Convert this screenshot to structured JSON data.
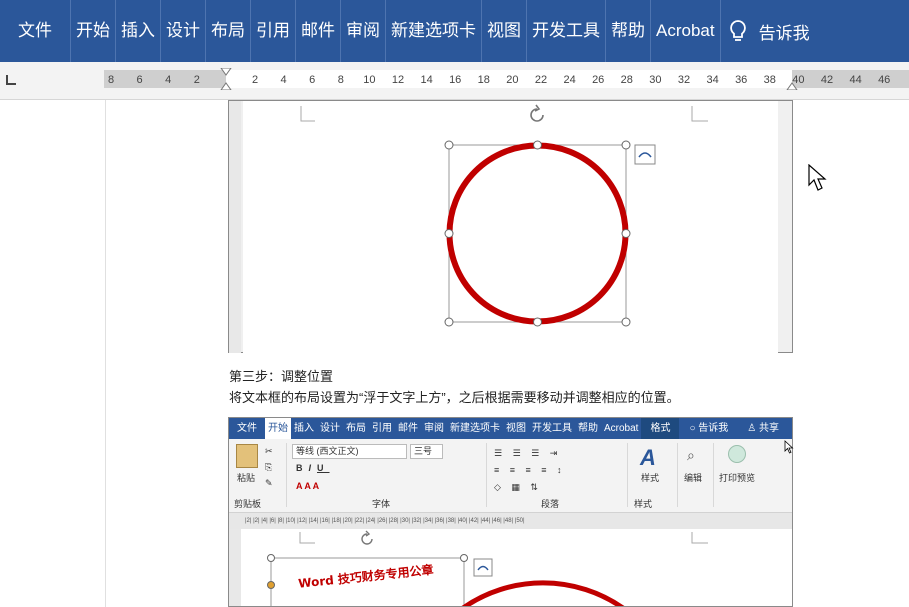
{
  "ribbon": {
    "tabs": [
      "文件",
      "开始",
      "插入",
      "设计",
      "布局",
      "引用",
      "邮件",
      "审阅",
      "新建选项卡",
      "视图",
      "开发工具",
      "帮助",
      "Acrobat"
    ],
    "tell_me": "告诉我"
  },
  "ruler": {
    "left_labels": [
      "8",
      "6",
      "4",
      "2"
    ],
    "right_labels": [
      "2",
      "4",
      "6",
      "8",
      "10",
      "12",
      "14",
      "16",
      "18",
      "20",
      "22",
      "24",
      "26",
      "28",
      "30",
      "32",
      "34",
      "36",
      "38",
      "40",
      "42",
      "44",
      "46"
    ]
  },
  "doc": {
    "step": "第三步：调整位置",
    "desc": "将文本框的布局设置为“浮于文字上方”，之后根据需要移动并调整相应的位置。"
  },
  "mini": {
    "tabs": [
      "文件",
      "开始",
      "插入",
      "设计",
      "布局",
      "引用",
      "邮件",
      "审阅",
      "新建选项卡",
      "视图",
      "开发工具",
      "帮助",
      "Acrobat"
    ],
    "format_tab": "格式",
    "tell_me": "告诉我",
    "share": "共享",
    "paste": "粘贴",
    "font_name": "等线 (西文正文)",
    "font_size": "三号",
    "styles": "样式",
    "edit": "编辑",
    "print_preview": "打印预览",
    "groups": {
      "clipboard": "剪贴板",
      "font": "字体",
      "paragraph": "段落",
      "styles": "样式"
    },
    "ruler_text": "|2| |2| |4| |6| |8| |10| |12| |14| |16| |18| |20| |22| |24| |26| |28| |30| |32| |34| |36| |38| |40| |42| |44| |46| |48| |50|",
    "stamp_text": "Word 技巧财务专用公章"
  },
  "colors": {
    "ribbon": "#2b579a",
    "stamp": "#c00000"
  }
}
